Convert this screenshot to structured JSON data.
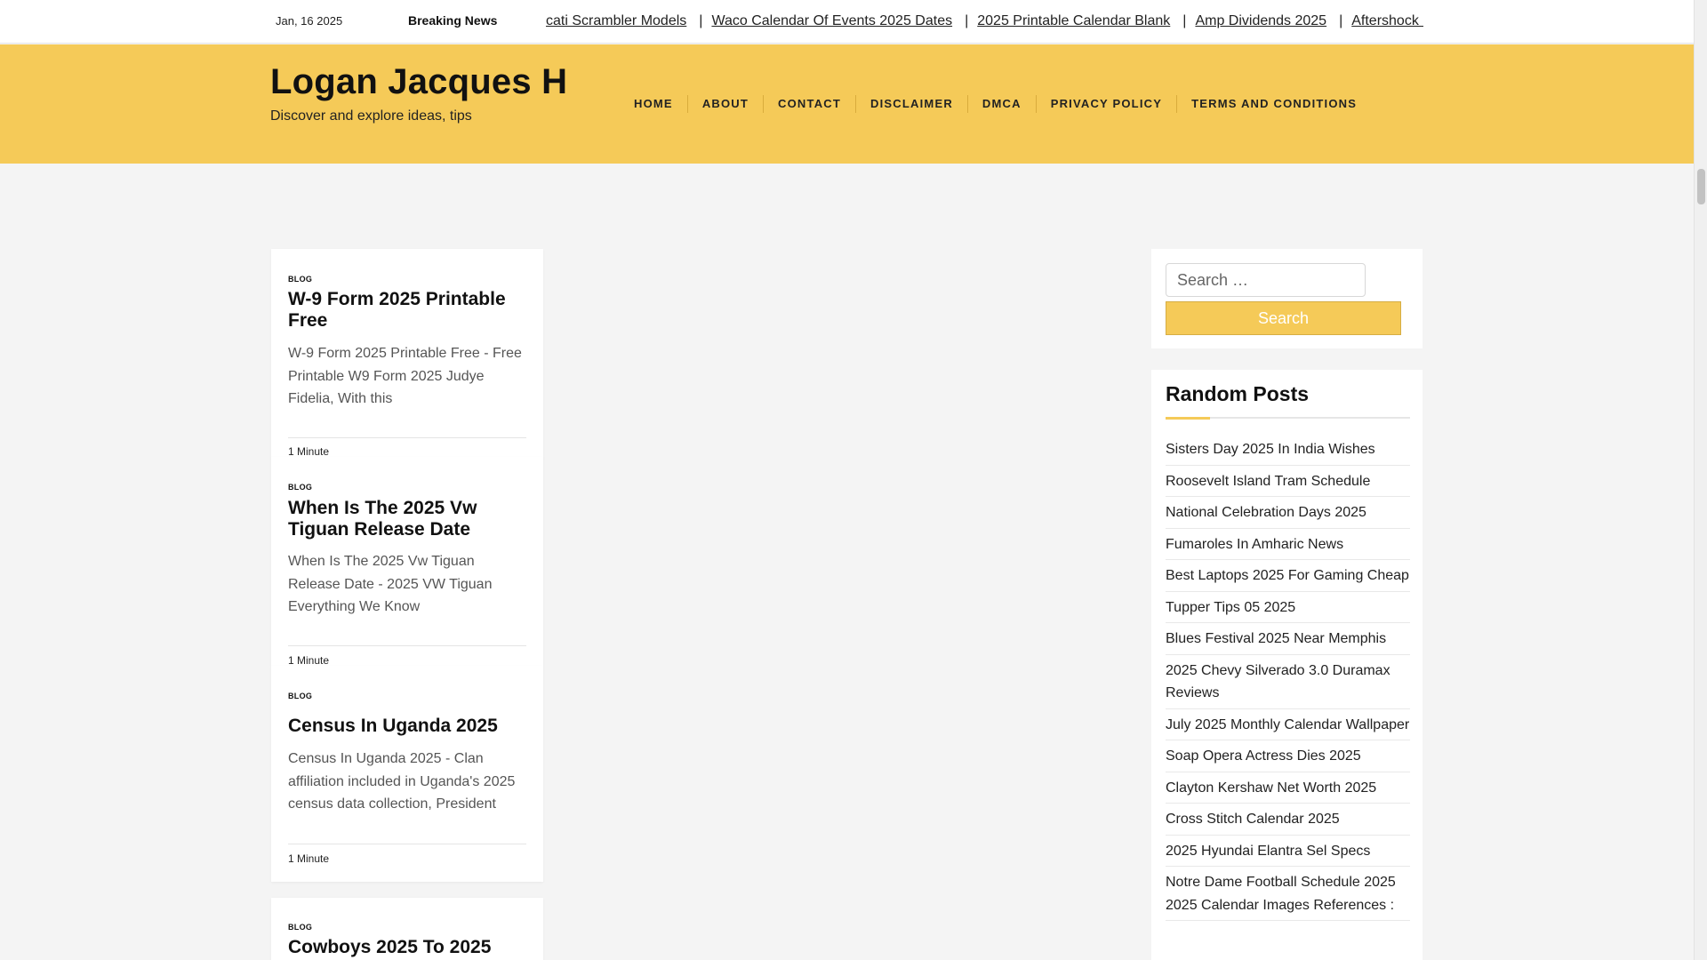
{
  "topbar": {
    "date": "Jan, 16 2025",
    "breaking_label": "Breaking News",
    "ticker": [
      "cati Scrambler Models",
      "Waco Calendar Of Events 2025 Dates",
      "2025 Printable Calendar Blank",
      "Amp Dividends 2025",
      "Aftershock M"
    ],
    "separator": "|"
  },
  "header": {
    "title": "Logan Jacques H",
    "tagline": "Discover and explore ideas, tips",
    "nav": [
      "HOME",
      "ABOUT",
      "CONTACT",
      "DISCLAIMER",
      "DMCA",
      "PRIVACY POLICY",
      "TERMS AND CONDITIONS"
    ]
  },
  "posts": [
    {
      "category": "BLOG",
      "title": "W-9 Form 2025 Printable Free",
      "excerpt": "W-9 Form 2025 Printable Free - Free Printable W9 Form 2025 Judye Fidelia, With this",
      "read_time": "1 Minute"
    },
    {
      "category": "BLOG",
      "title": "When Is The 2025 Vw Tiguan Release Date",
      "excerpt": "When Is The 2025 Vw Tiguan Release Date - 2025 VW Tiguan Everything We Know",
      "read_time": "1 Minute"
    },
    {
      "category": "BLOG",
      "title": "Census In Uganda 2025",
      "excerpt": "Census In Uganda 2025 - Clan affiliation included in Uganda's 2025 census data collection, President",
      "read_time": "1 Minute"
    },
    {
      "category": "BLOG",
      "title": "Cowboys 2025 To 2025"
    }
  ],
  "sidebar": {
    "search": {
      "placeholder": "Search …",
      "button_label": "Search"
    },
    "random_posts": {
      "title": "Random Posts",
      "items": [
        "Sisters Day 2025 In India Wishes",
        "Roosevelt Island Tram Schedule",
        "National Celebration Days 2025",
        "Fumaroles In Amharic News",
        "Best Laptops 2025 For Gaming Cheap",
        "Tupper Tips 05 2025",
        "Blues Festival 2025 Near Memphis",
        "2025 Chevy Silverado 3.0 Duramax Reviews",
        "July 2025 Monthly Calendar Wallpaper",
        "Soap Opera Actress Dies 2025",
        "Clayton Kershaw Net Worth 2025",
        "Cross Stitch Calendar 2025",
        "2025 Hyundai Elantra Sel Specs",
        "Notre Dame Football Schedule 2025 2025 Calendar Images References :"
      ]
    }
  },
  "colors": {
    "accent": "#f5ca58",
    "background": "#f4f4f4"
  }
}
